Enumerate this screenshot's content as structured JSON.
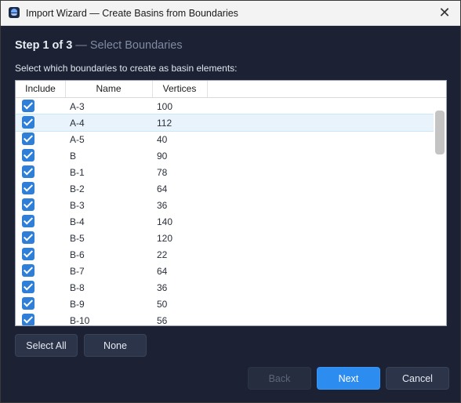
{
  "window": {
    "title": "Import Wizard — Create Basins from Boundaries",
    "close_glyph": "✕"
  },
  "step": {
    "number": "Step 1 of 3",
    "separator": " — ",
    "name": "Select Boundaries"
  },
  "instruction": "Select which boundaries to create as basin elements:",
  "table": {
    "columns": [
      "Include",
      "Name",
      "Vertices"
    ],
    "selected_row": 1,
    "rows": [
      {
        "include": true,
        "name": "A-3",
        "vertices": "100"
      },
      {
        "include": true,
        "name": "A-4",
        "vertices": "112"
      },
      {
        "include": true,
        "name": "A-5",
        "vertices": "40"
      },
      {
        "include": true,
        "name": "B",
        "vertices": "90"
      },
      {
        "include": true,
        "name": "B-1",
        "vertices": "78"
      },
      {
        "include": true,
        "name": "B-2",
        "vertices": "64"
      },
      {
        "include": true,
        "name": "B-3",
        "vertices": "36"
      },
      {
        "include": true,
        "name": "B-4",
        "vertices": "140"
      },
      {
        "include": true,
        "name": "B-5",
        "vertices": "120"
      },
      {
        "include": true,
        "name": "B-6",
        "vertices": "22"
      },
      {
        "include": true,
        "name": "B-7",
        "vertices": "64"
      },
      {
        "include": true,
        "name": "B-8",
        "vertices": "36"
      },
      {
        "include": true,
        "name": "B-9",
        "vertices": "50"
      },
      {
        "include": true,
        "name": "B-10",
        "vertices": "56"
      }
    ]
  },
  "buttons": {
    "select_all": "Select All",
    "none": "None",
    "back": "Back",
    "next": "Next",
    "cancel": "Cancel"
  },
  "colors": {
    "accent": "#2d8cf0",
    "background": "#1c2233",
    "checkbox": "#2f7fd8"
  }
}
